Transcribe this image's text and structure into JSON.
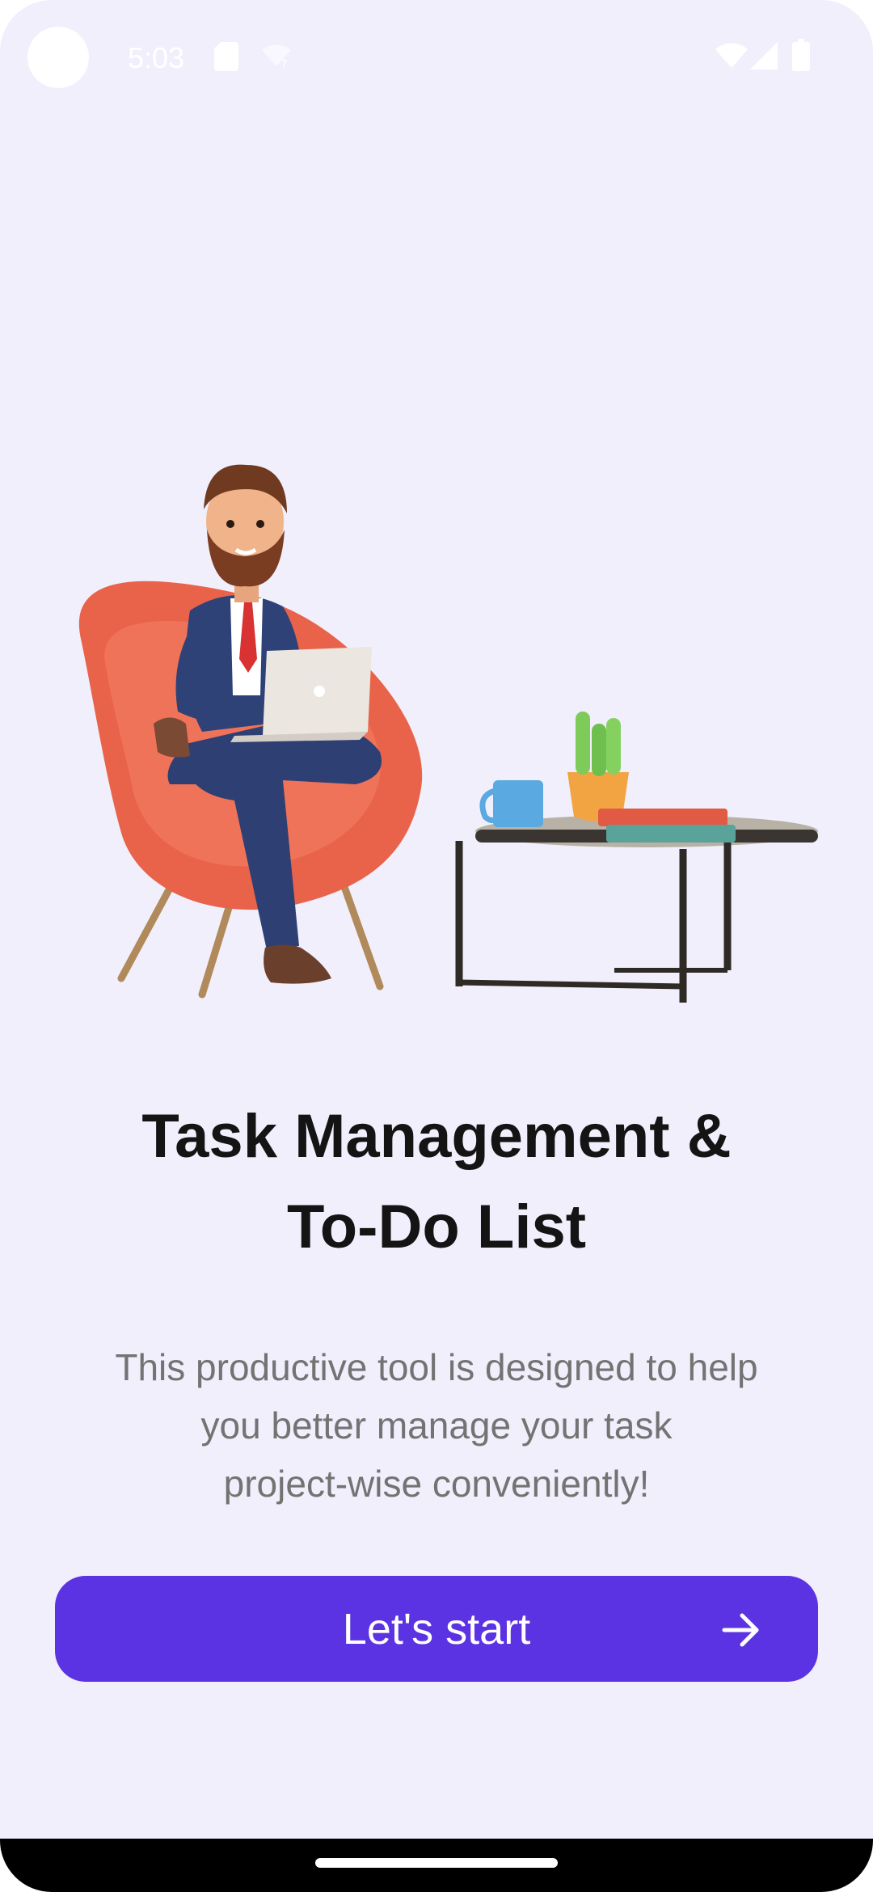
{
  "status_bar": {
    "time": "5:03",
    "icons": [
      "sd-card-icon",
      "wifi-off-icon",
      "wifi-icon",
      "signal-icon",
      "battery-icon"
    ]
  },
  "onboarding": {
    "title_line1": "Task Management &",
    "title_line2": "To-Do List",
    "description_line1": "This productive tool is designed to help",
    "description_line2": "you better manage your task",
    "description_line3": "project-wise conveniently!",
    "button_label": "Let's start"
  },
  "colors": {
    "background": "#f1effc",
    "accent": "#5c33e2",
    "title": "#141414",
    "body_text": "#737373"
  }
}
